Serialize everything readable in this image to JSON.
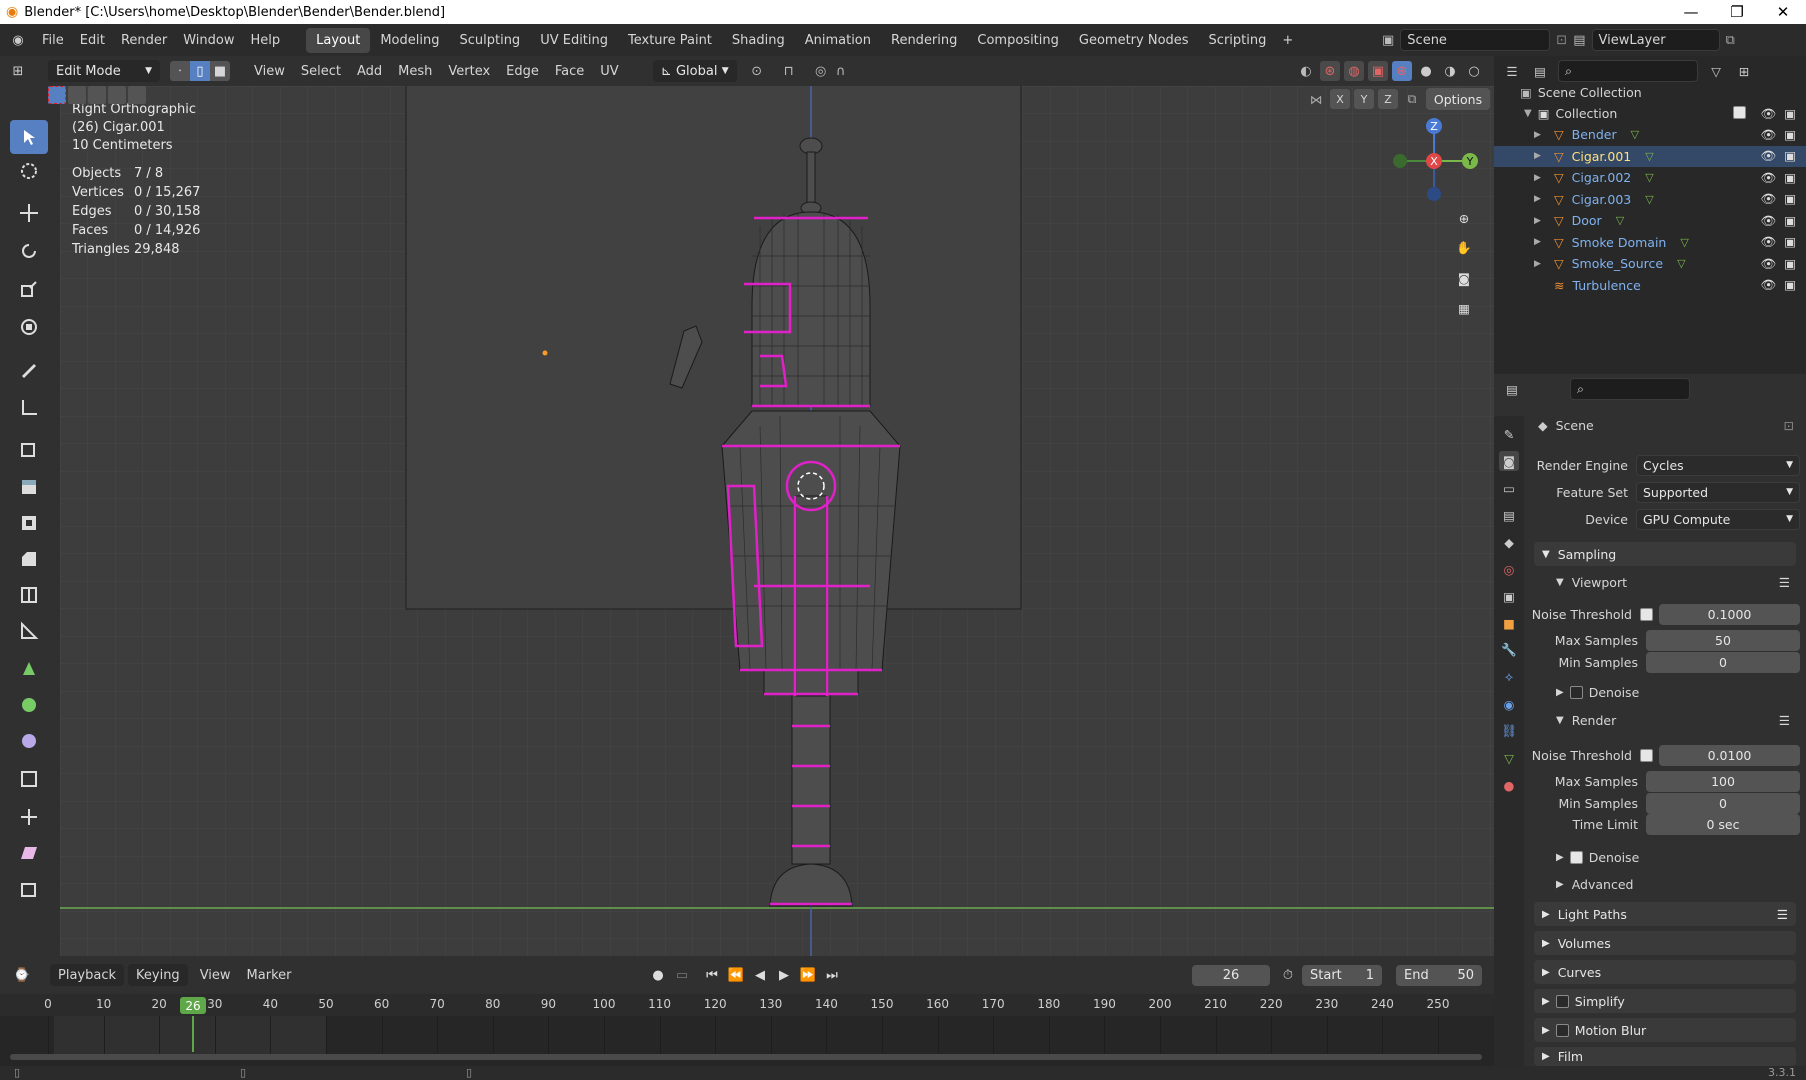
{
  "window": {
    "title": "Blender* [C:\\Users\\home\\Desktop\\Blender\\Bender\\Bender.blend]",
    "controls": [
      "—",
      "❐",
      "✕"
    ]
  },
  "menu": [
    "File",
    "Edit",
    "Render",
    "Window",
    "Help"
  ],
  "workspaces": [
    "Layout",
    "Modeling",
    "Sculpting",
    "UV Editing",
    "Texture Paint",
    "Shading",
    "Animation",
    "Rendering",
    "Compositing",
    "Geometry Nodes",
    "Scripting"
  ],
  "active_workspace": "Layout",
  "scene": {
    "name": "Scene",
    "view_layer": "ViewLayer"
  },
  "viewport_header": {
    "mode": "Edit Mode",
    "menus": [
      "View",
      "Select",
      "Add",
      "Mesh",
      "Vertex",
      "Edge",
      "Face",
      "UV"
    ],
    "orientation": "Global",
    "options": "Options",
    "axes": [
      "X",
      "Y",
      "Z"
    ]
  },
  "overlay": {
    "view": "Right Orthographic",
    "object": "(26) Cigar.001",
    "scale": "10 Centimeters",
    "stats": [
      {
        "label": "Objects",
        "value": "7 / 8"
      },
      {
        "label": "Vertices",
        "value": "0 / 15,267"
      },
      {
        "label": "Edges",
        "value": "0 / 30,158"
      },
      {
        "label": "Faces",
        "value": "0 / 14,926"
      },
      {
        "label": "Triangles",
        "value": "29,848"
      }
    ]
  },
  "gizmo": {
    "z": "Z",
    "x": "X",
    "y": "Y"
  },
  "outliner": {
    "root": "Scene Collection",
    "collection": "Collection",
    "items": [
      {
        "name": "Bender",
        "selected": false
      },
      {
        "name": "Cigar.001",
        "selected": true
      },
      {
        "name": "Cigar.002",
        "selected": false
      },
      {
        "name": "Cigar.003",
        "selected": false
      },
      {
        "name": "Door",
        "selected": false
      },
      {
        "name": "Smoke Domain",
        "selected": false
      },
      {
        "name": "Smoke_Source",
        "selected": false
      },
      {
        "name": "Turbulence",
        "selected": false
      }
    ]
  },
  "properties": {
    "context": "Scene",
    "render_engine_label": "Render Engine",
    "render_engine": "Cycles",
    "feature_set_label": "Feature Set",
    "feature_set": "Supported",
    "device_label": "Device",
    "device": "GPU Compute",
    "sampling": "Sampling",
    "viewport": "Viewport",
    "render": "Render",
    "noise_threshold_label": "Noise Threshold",
    "max_samples_label": "Max Samples",
    "min_samples_label": "Min Samples",
    "time_limit_label": "Time Limit",
    "vp_noise_threshold": "0.1000",
    "vp_max_samples": "50",
    "vp_min_samples": "0",
    "r_noise_threshold": "0.0100",
    "r_max_samples": "100",
    "r_min_samples": "0",
    "r_time_limit": "0 sec",
    "denoise": "Denoise",
    "advanced": "Advanced",
    "panels": [
      "Light Paths",
      "Volumes",
      "Curves",
      "Simplify",
      "Motion Blur",
      "Film"
    ]
  },
  "timeline": {
    "menus": [
      "Playback",
      "Keying",
      "View",
      "Marker"
    ],
    "current_frame": "26",
    "start_label": "Start",
    "start": "1",
    "end_label": "End",
    "end": "50",
    "ticks": [
      "0",
      "10",
      "20",
      "30",
      "40",
      "50",
      "60",
      "70",
      "80",
      "90",
      "100",
      "110",
      "120",
      "130",
      "140",
      "150",
      "160",
      "170",
      "180",
      "190",
      "200",
      "210",
      "220",
      "230",
      "240",
      "250"
    ]
  },
  "version": "3.3.1"
}
